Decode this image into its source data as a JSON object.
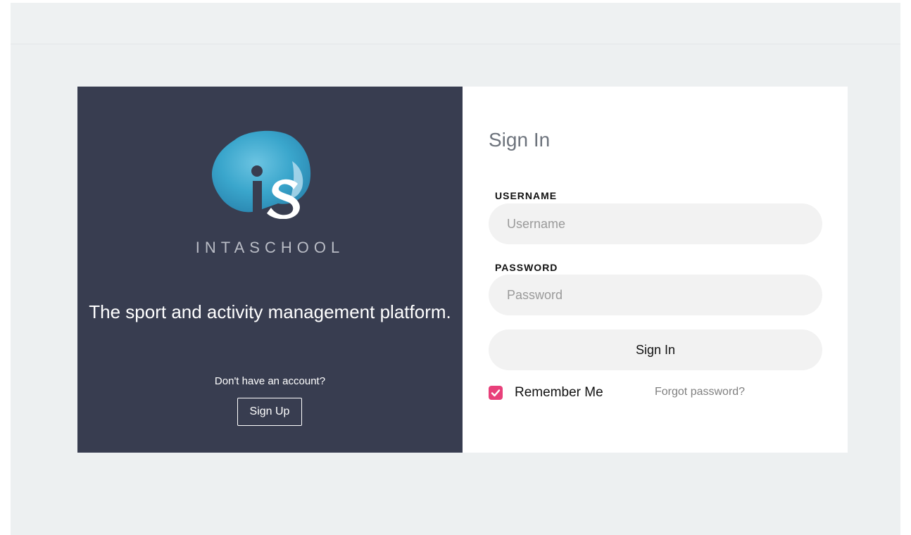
{
  "brand": {
    "name": "INTASCHOOL",
    "tagline": "The sport and activity management platform."
  },
  "signup": {
    "prompt": "Don't have an account?",
    "button_label": "Sign Up"
  },
  "signin": {
    "title": "Sign In",
    "username_label": "USERNAME",
    "username_placeholder": "Username",
    "username_value": "",
    "password_label": "PASSWORD",
    "password_placeholder": "Password",
    "password_value": "",
    "submit_label": "Sign In",
    "remember_label": "Remember Me",
    "remember_checked": true,
    "forgot_label": "Forgot password?"
  },
  "colors": {
    "left_panel_bg": "#383d50",
    "checkbox_accent": "#e8407a",
    "logo_blue": "#3aa6cc"
  }
}
